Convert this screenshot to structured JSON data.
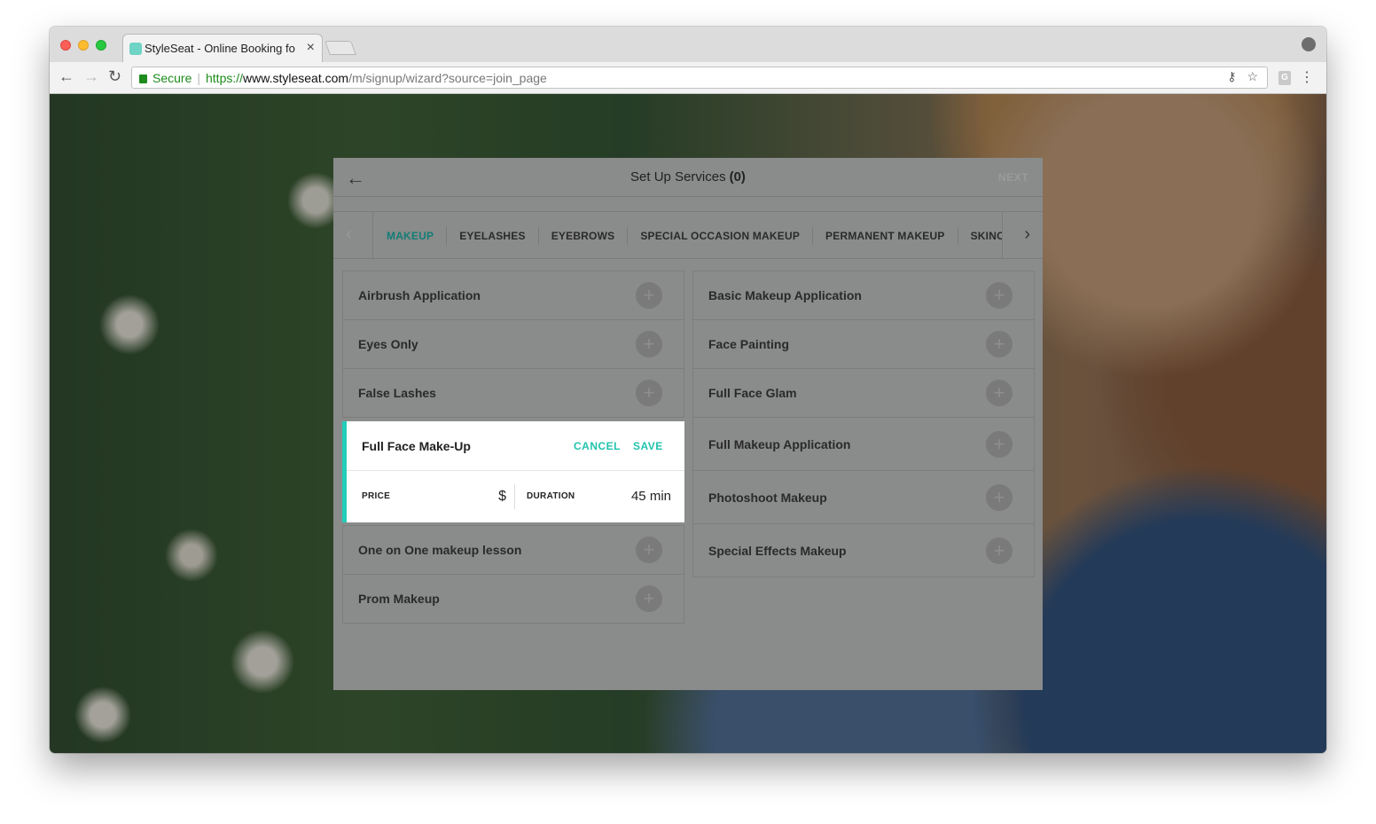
{
  "browser": {
    "tab_title": "StyleSeat - Online Booking for",
    "tab_close": "×",
    "secure_label": "Secure",
    "url_protocol": "https://",
    "url_host": "www.styleseat.com",
    "url_path": "/m/signup/wizard?source=join_page"
  },
  "modal": {
    "title": "Set Up Services",
    "count": "(0)",
    "next_label": "NEXT",
    "back_icon": "arrow-left-icon"
  },
  "categories": [
    {
      "label": "MAKEUP",
      "active": true
    },
    {
      "label": "EYELASHES",
      "active": false
    },
    {
      "label": "EYEBROWS",
      "active": false
    },
    {
      "label": "SPECIAL OCCASION MAKEUP",
      "active": false
    },
    {
      "label": "PERMANENT MAKEUP",
      "active": false
    },
    {
      "label": "SKINCARE",
      "active": false
    }
  ],
  "services_left": [
    "Airbrush Application",
    "Eyes Only",
    "False Lashes"
  ],
  "editor": {
    "name": "Full Face Make-Up",
    "cancel_label": "CANCEL",
    "save_label": "SAVE",
    "price_label": "PRICE",
    "price_value": "$",
    "duration_label": "DURATION",
    "duration_value": "45 min"
  },
  "services_left_after": [
    "One on One makeup lesson",
    "Prom Makeup"
  ],
  "services_right": [
    "Basic Makeup Application",
    "Face Painting",
    "Full Face Glam",
    "Full Makeup Application",
    "Photoshoot Makeup",
    "Special Effects Makeup"
  ],
  "colors": {
    "accent": "#21c3ad",
    "active_tab": "#127d75"
  }
}
